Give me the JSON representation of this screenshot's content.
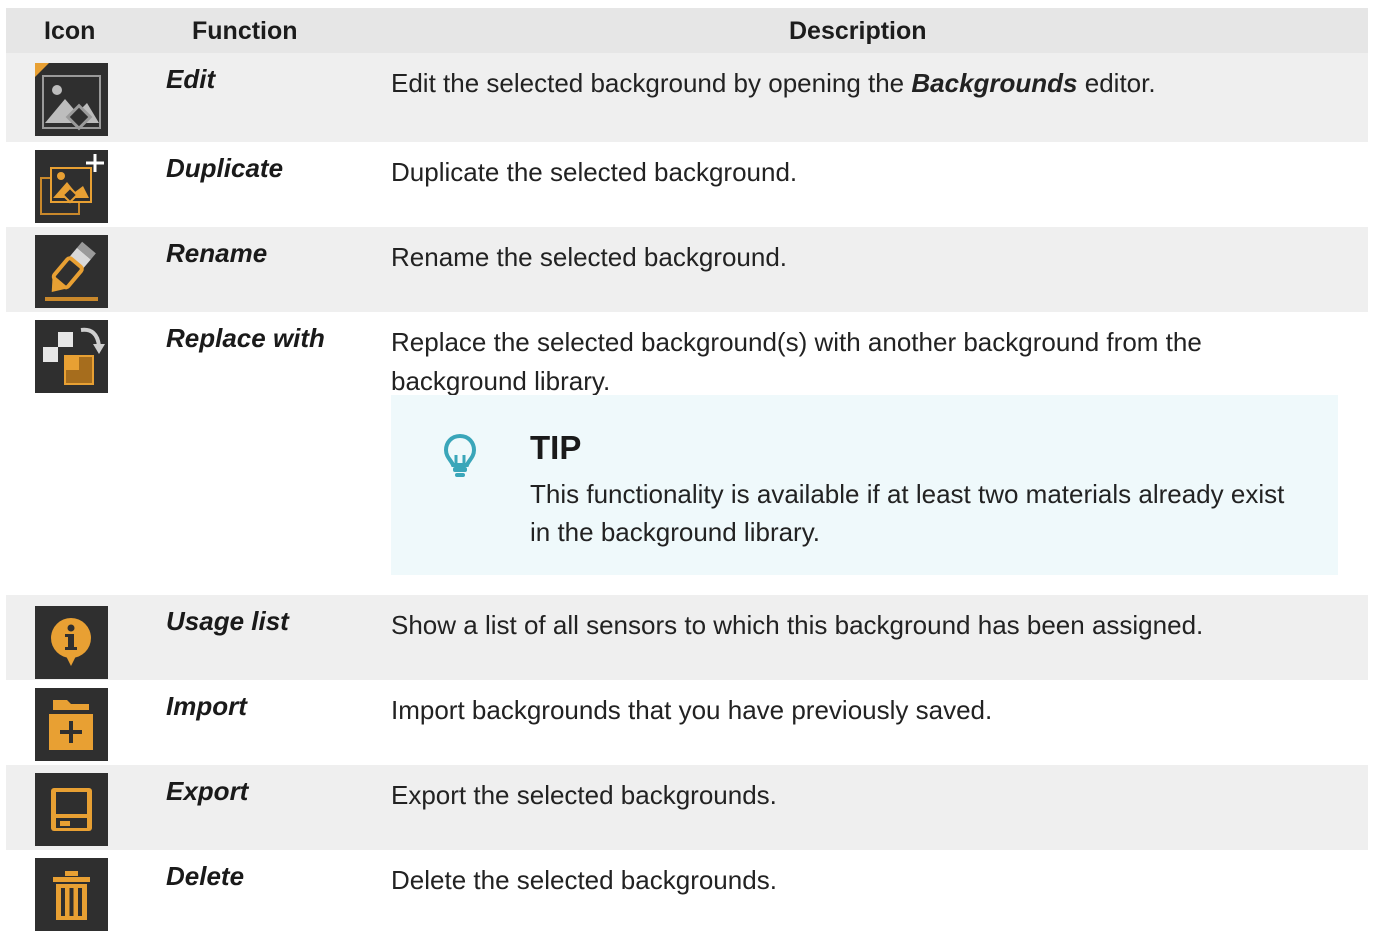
{
  "header": {
    "icon": "Icon",
    "function": "Function",
    "description": "Description"
  },
  "rows": [
    {
      "icon": "edit-background-icon",
      "function": "Edit",
      "description_before": "Edit the selected background by opening the ",
      "description_emphasis": "Backgrounds",
      "description_after": " editor."
    },
    {
      "icon": "duplicate-background-icon",
      "function": "Duplicate",
      "description": "Duplicate the selected background."
    },
    {
      "icon": "rename-pencil-icon",
      "function": "Rename",
      "description": "Rename the selected background."
    },
    {
      "icon": "replace-with-icon",
      "function": "Replace with",
      "description": "Replace the selected background(s) with another background from the background library.",
      "tip": {
        "title": "TIP",
        "text": "This functionality is available if at least two materials already exist in the background library.",
        "icon": "lightbulb-icon"
      }
    },
    {
      "icon": "info-usage-list-icon",
      "function": "Usage list",
      "description": "Show a list of all sensors to which this background has been assigned."
    },
    {
      "icon": "import-folder-icon",
      "function": "Import",
      "description": "Import backgrounds that you have previously saved."
    },
    {
      "icon": "export-save-icon",
      "function": "Export",
      "description": "Export the selected backgrounds."
    },
    {
      "icon": "delete-trash-icon",
      "function": "Delete",
      "description": "Delete the selected backgrounds."
    }
  ],
  "colors": {
    "icon_background": "#2f2f2f",
    "icon_accent": "#e8a033",
    "tip_background": "#eff9fb",
    "tip_icon": "#3aa6b9",
    "row_shade": "#efefef",
    "header_background": "#e6e6e6"
  }
}
